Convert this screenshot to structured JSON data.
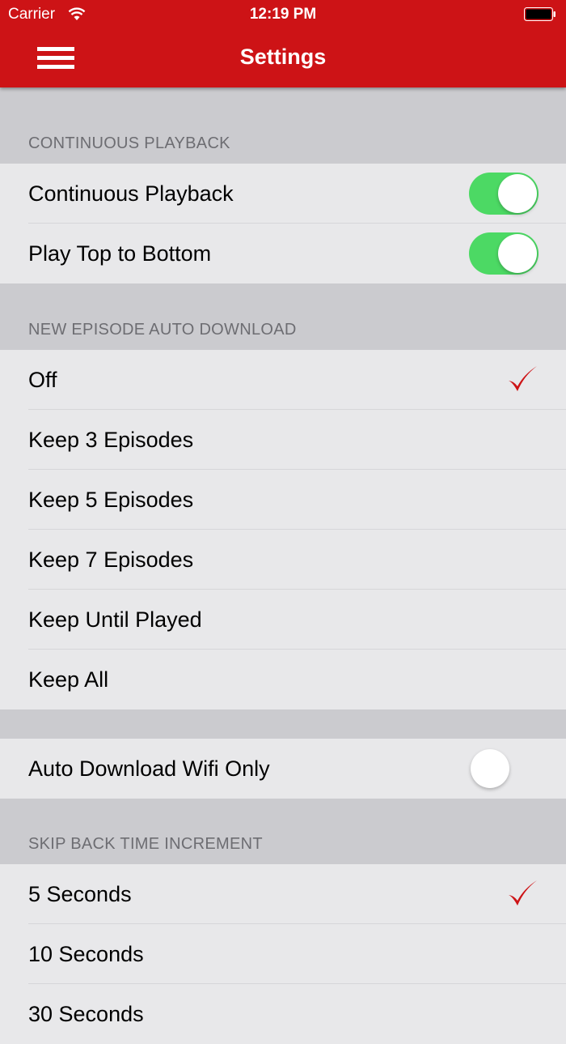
{
  "status": {
    "carrier": "Carrier",
    "time": "12:19 PM"
  },
  "nav": {
    "title": "Settings"
  },
  "colors": {
    "brand": "#cd1316",
    "toggle_on": "#4cd964",
    "check": "#cd1316"
  },
  "sections": {
    "continuous": {
      "header": "CONTINUOUS PLAYBACK",
      "items": [
        {
          "label": "Continuous Playback",
          "on": true
        },
        {
          "label": "Play Top to Bottom",
          "on": true
        }
      ]
    },
    "auto_download": {
      "header": "NEW EPISODE AUTO DOWNLOAD",
      "items": [
        {
          "label": "Off",
          "selected": true
        },
        {
          "label": "Keep 3 Episodes",
          "selected": false
        },
        {
          "label": "Keep 5 Episodes",
          "selected": false
        },
        {
          "label": "Keep 7 Episodes",
          "selected": false
        },
        {
          "label": "Keep Until Played",
          "selected": false
        },
        {
          "label": "Keep All",
          "selected": false
        }
      ]
    },
    "wifi": {
      "items": [
        {
          "label": "Auto Download Wifi Only",
          "on": false
        }
      ]
    },
    "skip_back": {
      "header": "SKIP BACK TIME INCREMENT",
      "items": [
        {
          "label": "5 Seconds",
          "selected": true
        },
        {
          "label": "10 Seconds",
          "selected": false
        },
        {
          "label": "30 Seconds",
          "selected": false
        }
      ]
    }
  }
}
